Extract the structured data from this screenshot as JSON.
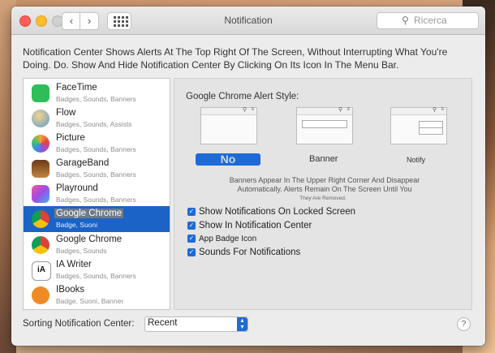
{
  "window": {
    "title": "Notification"
  },
  "search": {
    "placeholder": "Ricerca"
  },
  "description": "Notification Center Shows Alerts At The Top Right Of The Screen, Without Interrupting What You're Doing. Do. Show And Hide Notification Center By Clicking On Its Icon In The Menu Bar.",
  "apps": [
    {
      "name": "FaceTime",
      "sub": "Badges, Sounds, Banners",
      "icon": "facetime-icon",
      "color": "#2ebd59"
    },
    {
      "name": "Flow",
      "sub": "Badges, Sounds, Assists",
      "icon": "flow-icon",
      "color": "#5b9bd5"
    },
    {
      "name": "Picture",
      "sub": "Badges, Sounds, Banners",
      "icon": "photos-icon",
      "color": "#f2a33a"
    },
    {
      "name": "GarageBand",
      "sub": "Badges, Sounds, Banners",
      "icon": "garageband-icon",
      "color": "#b5702b"
    },
    {
      "name": "Playround",
      "sub": "Badges, Sounds, Banners",
      "icon": "playground-icon",
      "color": "#e64aa8"
    },
    {
      "name": "Google Chrome",
      "sub": "Badge, Suoni",
      "icon": "chrome-icon",
      "color": "#db4437"
    },
    {
      "name": "Google Chrome",
      "sub": "Badges, Sounds",
      "icon": "chrome-icon",
      "color": "#db4437"
    },
    {
      "name": "IA Writer",
      "sub": "Badges, Sounds, Banners",
      "icon": "ia-writer-icon",
      "color": "#ffffff"
    },
    {
      "name": "IBooks",
      "sub": "Badge, Suoni, Banner",
      "icon": "ibooks-icon",
      "color": "#f08a24"
    }
  ],
  "settings": {
    "alert_style_title": "Google Chrome Alert Style:",
    "styles": {
      "none": "No",
      "banner": "Banner",
      "notify": "Notify"
    },
    "info_line1": "Banners Appear In The Upper Right Corner And Disappear",
    "info_line2": "Automatically. Alerts Remain On The Screen Until You",
    "info_line3": "They Are Removed.",
    "options": [
      "Show Notifications On Locked Screen",
      "Show In Notification Center",
      "App Badge Icon",
      "Sounds For Notifications"
    ]
  },
  "sorting": {
    "label": "Sorting Notification Center:",
    "value": "Recent"
  },
  "colors": {
    "accent": "#1e6ad6",
    "selection": "#1b63c6"
  }
}
